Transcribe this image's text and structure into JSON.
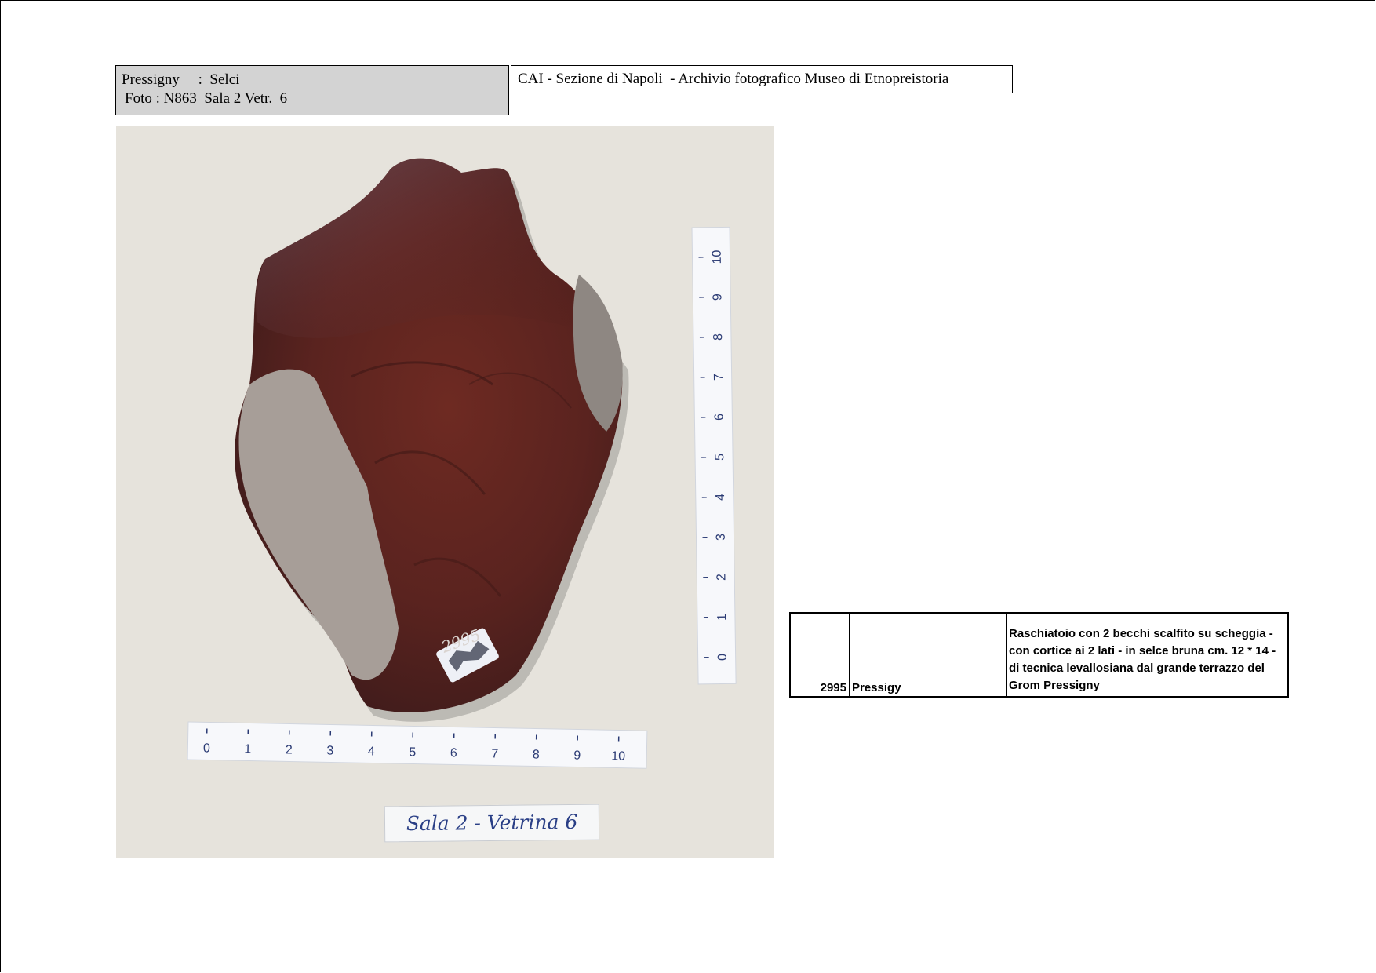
{
  "header": {
    "left_line1": "Pressigny     :  Selci",
    "left_line2": "Foto : N863  Sala 2 Vetr.  6",
    "right_title": "CAI - Sezione di Napoli  - Archivio fotografico Museo di Etnopreistoria"
  },
  "photo": {
    "specimen_number": "2995",
    "ruler_horizontal_labels": [
      "0",
      "1",
      "2",
      "3",
      "4",
      "5",
      "6",
      "7",
      "8",
      "9",
      "10"
    ],
    "ruler_vertical_labels": [
      "0",
      "1",
      "2",
      "3",
      "4",
      "5",
      "6",
      "7",
      "8",
      "9",
      "10"
    ],
    "handwritten_label": "Sala 2 - Vetrina 6"
  },
  "record": {
    "number": "2995",
    "site": "Pressigy",
    "description": "Raschiatoio con 2 becchi scalfito su scheggia - con cortice ai 2 lati - in selce bruna cm. 12 * 14 - di tecnica levallosiana dal grande terrazzo del Grom Pressigny"
  }
}
